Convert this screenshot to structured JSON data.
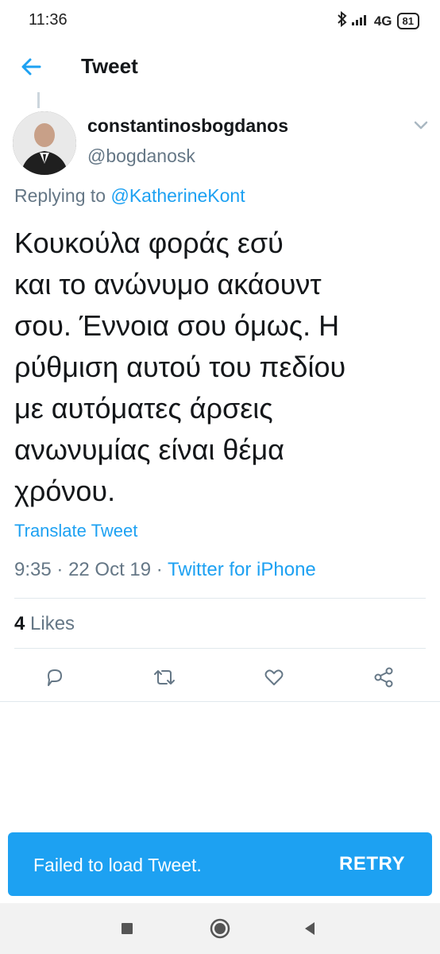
{
  "status_bar": {
    "time": "11:36",
    "network": "4G",
    "battery": "81"
  },
  "header": {
    "title": "Tweet"
  },
  "tweet": {
    "display_name": "constantinosbogdanos",
    "handle": "@bogdanosk",
    "replying_prefix": "Replying to",
    "replying_to": "@KatherineKont",
    "text_lines": [
      "Κουκούλα φοράς εσύ",
      "και το ανώνυμο ακάουντ",
      "σου. Έννοια σου όμως. Η",
      "ρύθμιση αυτού του πεδίου",
      "με αυτόματες άρσεις",
      "ανωνυμίας είναι θέμα",
      "χρόνου."
    ],
    "translate_label": "Translate Tweet",
    "time": "9:35",
    "date": "22 Oct 19",
    "source": "Twitter for iPhone",
    "likes_count": "4",
    "likes_label": "Likes"
  },
  "icons": {
    "back": "arrow-left-icon",
    "reply": "reply-icon",
    "retweet": "retweet-icon",
    "like": "heart-icon",
    "share": "share-icon",
    "caret": "chevron-down-icon"
  },
  "snackbar": {
    "message": "Failed to load Tweet.",
    "action": "RETRY"
  },
  "colors": {
    "accent": "#1da1f2",
    "secondary_text": "#657786",
    "primary_text": "#14171a"
  }
}
